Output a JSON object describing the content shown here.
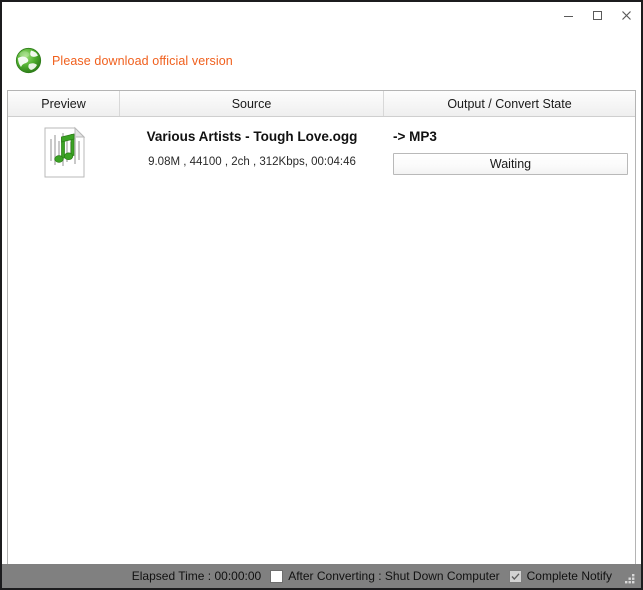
{
  "window": {
    "controls": {
      "minimize_label": "Minimize",
      "maximize_label": "Maximize",
      "close_label": "Close"
    }
  },
  "banner": {
    "icon": "globe-icon",
    "text": "Please download official version",
    "color": "#F0601E"
  },
  "columns": [
    {
      "label": "Preview"
    },
    {
      "label": "Source"
    },
    {
      "label": "Output / Convert State"
    }
  ],
  "rows": [
    {
      "icon": "audio-file-icon",
      "source_title": "Various Artists - Tough Love.ogg",
      "source_meta": "9.08M , 44100 , 2ch , 312Kbps, 00:04:46",
      "output_format": "-> MP3",
      "state": "Waiting"
    }
  ],
  "statusbar": {
    "elapsed_label": "Elapsed Time : 00:00:00",
    "shutdown_label": "After Converting : Shut Down Computer",
    "shutdown_checked": false,
    "notify_label": "Complete Notify",
    "notify_checked": true,
    "grip": "resize-grip-icon"
  }
}
